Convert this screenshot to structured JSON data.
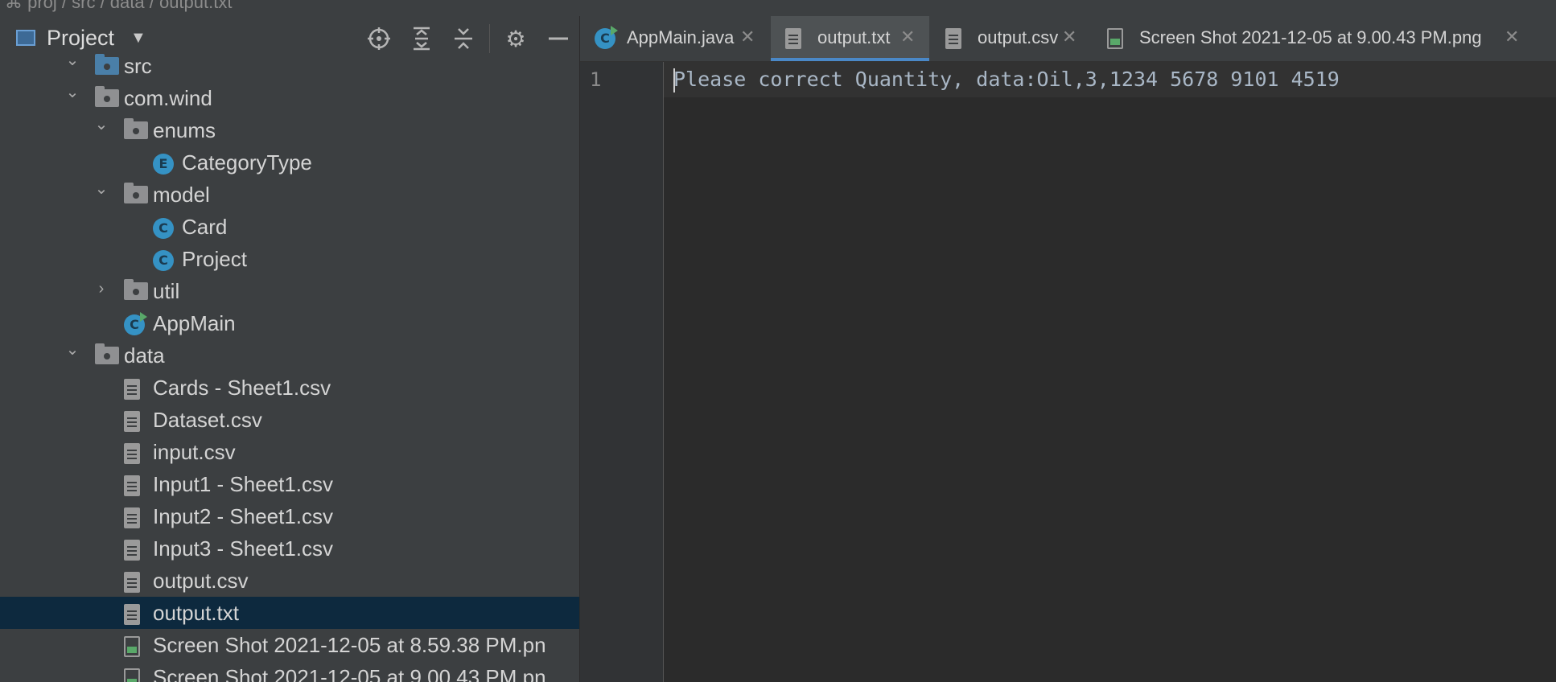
{
  "breadcrumb": "⌘ proj  /  src  /  data  /  output.txt",
  "project": {
    "title": "Project",
    "toolbar": [
      "locate-icon",
      "expand-all-icon",
      "collapse-all-icon",
      "gear-icon",
      "minimize-icon"
    ]
  },
  "tree": [
    {
      "label": "src",
      "depth": 1,
      "kind": "folder-blue",
      "expanded": true
    },
    {
      "label": "com.wind",
      "depth": 1,
      "kind": "folder",
      "expanded": true
    },
    {
      "label": "enums",
      "depth": 2,
      "kind": "folder",
      "expanded": true
    },
    {
      "label": "CategoryType",
      "depth": 3,
      "kind": "enum"
    },
    {
      "label": "model",
      "depth": 2,
      "kind": "folder",
      "expanded": true
    },
    {
      "label": "Card",
      "depth": 3,
      "kind": "class"
    },
    {
      "label": "Project",
      "depth": 3,
      "kind": "class"
    },
    {
      "label": "util",
      "depth": 2,
      "kind": "folder",
      "expanded": false
    },
    {
      "label": "AppMain",
      "depth": 2,
      "kind": "class-run"
    },
    {
      "label": "data",
      "depth": 1,
      "kind": "folder",
      "expanded": true
    },
    {
      "label": "Cards - Sheet1.csv",
      "depth": 2,
      "kind": "file"
    },
    {
      "label": "Dataset.csv",
      "depth": 2,
      "kind": "file"
    },
    {
      "label": "input.csv",
      "depth": 2,
      "kind": "file"
    },
    {
      "label": "Input1 - Sheet1.csv",
      "depth": 2,
      "kind": "file"
    },
    {
      "label": "Input2 - Sheet1.csv",
      "depth": 2,
      "kind": "file"
    },
    {
      "label": "Input3 - Sheet1.csv",
      "depth": 2,
      "kind": "file"
    },
    {
      "label": "output.csv",
      "depth": 2,
      "kind": "file"
    },
    {
      "label": "output.txt",
      "depth": 2,
      "kind": "file",
      "selected": true
    },
    {
      "label": "Screen Shot 2021-12-05 at 8.59.38 PM.pn",
      "depth": 2,
      "kind": "image"
    },
    {
      "label": "Screen Shot 2021-12-05 at 9.00.43 PM.pn",
      "depth": 2,
      "kind": "image"
    }
  ],
  "tabs": [
    {
      "label": "AppMain.java",
      "icon": "class-run",
      "active": false
    },
    {
      "label": "output.txt",
      "icon": "file",
      "active": true
    },
    {
      "label": "output.csv",
      "icon": "file",
      "active": false
    },
    {
      "label": "Screen Shot 2021-12-05 at 9.00.43 PM.png",
      "icon": "image",
      "active": false
    }
  ],
  "editor": {
    "line_number": "1",
    "content": "Please correct Quantity, data:Oil,3,1234 5678 9101 4519"
  },
  "colors": {
    "selection": "#0d293e",
    "active_tab_underline": "#4a88c7",
    "class_icon": "#3592c4"
  }
}
